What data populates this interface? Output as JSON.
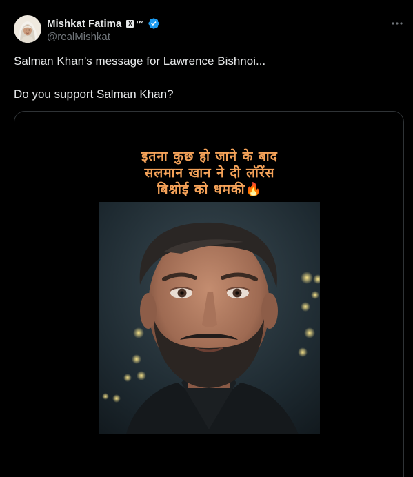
{
  "author": {
    "display_name": "Mishkat Fatima",
    "handle": "@realMishkat",
    "badge_x": "X",
    "badge_tm": "™",
    "verified_color": "#1d9bf0",
    "avatar_icon": "hijab-avatar-icon"
  },
  "tweet": {
    "line1": "Salman Khan's message for Lawrence Bishnoi...",
    "line2": "Do you support Salman Khan?"
  },
  "media": {
    "caption_line1": "इतना कुछ हो जाने के बाद",
    "caption_line2": "सलमान खान ने दी लॉरेंस",
    "caption_line3": "बिश्नोई को धमकी",
    "caption_emoji": "🔥",
    "caption_color": "#f4a259"
  },
  "colors": {
    "background": "#000000",
    "text": "#e7e9ea",
    "muted": "#71767b",
    "border": "#2f3336"
  }
}
